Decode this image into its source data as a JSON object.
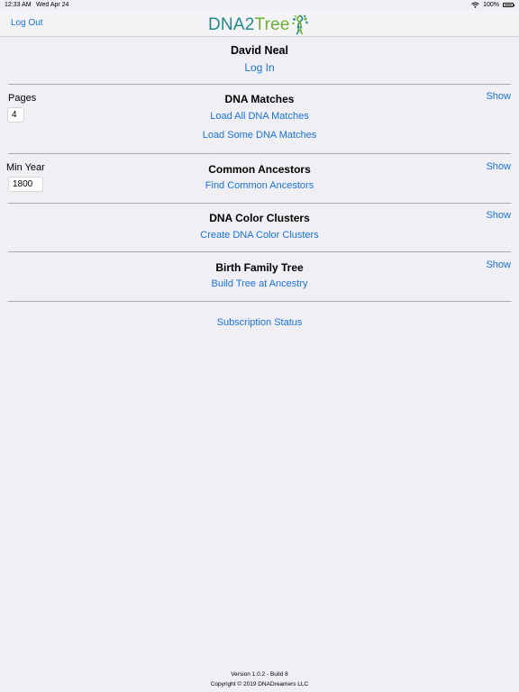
{
  "status_bar": {
    "time": "12:33 AM",
    "date": "Wed Apr 24",
    "battery": "100%"
  },
  "nav": {
    "logout_label": "Log Out",
    "logo": {
      "part1": "DNA",
      "part2": "2",
      "part3": "Tree"
    }
  },
  "account": {
    "name": "David Neal",
    "login_label": "Log In"
  },
  "sections": {
    "matches": {
      "title": "DNA Matches",
      "show_label": "Show",
      "field_label": "Pages",
      "field_value": "4",
      "actions": [
        "Load All DNA Matches",
        "Load Some DNA Matches"
      ]
    },
    "ancestors": {
      "title": "Common Ancestors",
      "show_label": "Show",
      "field_label": "Min Year",
      "field_value": "1800",
      "actions": [
        "Find Common Ancestors"
      ]
    },
    "clusters": {
      "title": "DNA Color Clusters",
      "show_label": "Show",
      "actions": [
        "Create DNA Color Clusters"
      ]
    },
    "tree": {
      "title": "Birth Family Tree",
      "show_label": "Show",
      "actions": [
        "Build Tree at Ancestry"
      ]
    }
  },
  "subscription_label": "Subscription Status",
  "footer": {
    "version": "Version 1.0.2 - Build 8",
    "copyright": "Copyright © 2019 DNADreamers LLC"
  },
  "colors": {
    "link": "#1a73d9",
    "logo_teal": "#1f8a8a",
    "logo_green": "#6fb02e",
    "background": "#efeff4"
  }
}
